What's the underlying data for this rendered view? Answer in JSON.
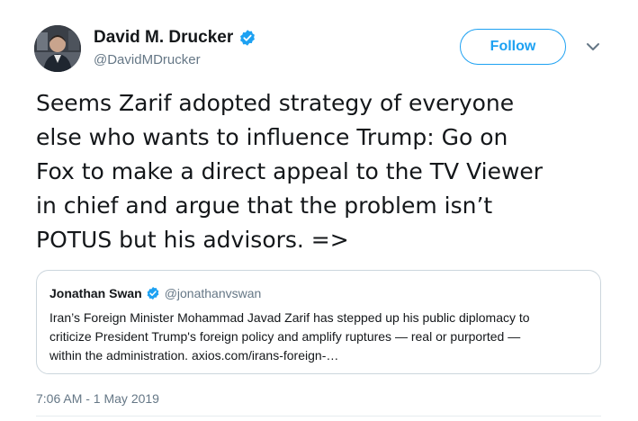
{
  "author": {
    "name": "David M. Drucker",
    "handle": "@DavidMDrucker",
    "verified": true,
    "avatar_icon": "profile-photo"
  },
  "follow_button": {
    "label": "Follow"
  },
  "menu": {
    "icon": "chevron-down-icon"
  },
  "tweet": {
    "text": "Seems Zarif adopted strategy of everyone\nelse who wants to influence Trump: Go on\nFox to make a direct appeal to the TV Viewer\nin chief and argue that the problem isn’t\nPOTUS but his advisors. =>"
  },
  "quoted_tweet": {
    "name": "Jonathan Swan",
    "handle": "@jonathanvswan",
    "verified": true,
    "text": "Iran’s Foreign Minister Mohammad Javad Zarif has stepped up his public diplomacy to\ncriticize President Trump's foreign policy and amplify ruptures — real or purported —\nwithin the administration. axios.com/irans-foreign-…"
  },
  "timestamp": "7:06 AM - 1 May 2019",
  "colors": {
    "accent": "#1da1f2",
    "text": "#14171a",
    "secondary": "#657786",
    "border": "#ccd6dd"
  }
}
